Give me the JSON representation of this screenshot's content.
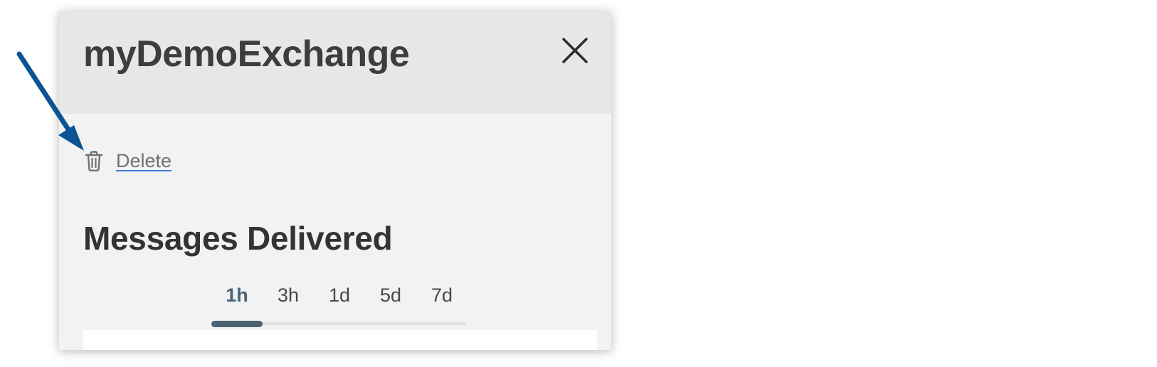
{
  "panel": {
    "title": "myDemoExchange",
    "close_icon": "close-icon"
  },
  "actions": {
    "delete_label": "Delete",
    "delete_icon": "trash-icon"
  },
  "messages": {
    "title": "Messages Delivered",
    "tabs": [
      {
        "label": "1h",
        "active": true
      },
      {
        "label": "3h",
        "active": false
      },
      {
        "label": "1d",
        "active": false
      },
      {
        "label": "5d",
        "active": false
      },
      {
        "label": "7d",
        "active": false
      }
    ]
  },
  "colors": {
    "header_bg": "#e6e7e9",
    "panel_bg": "#f2f2f2",
    "active_tab": "#4c6272",
    "annotation_arrow": "#0b5394"
  }
}
